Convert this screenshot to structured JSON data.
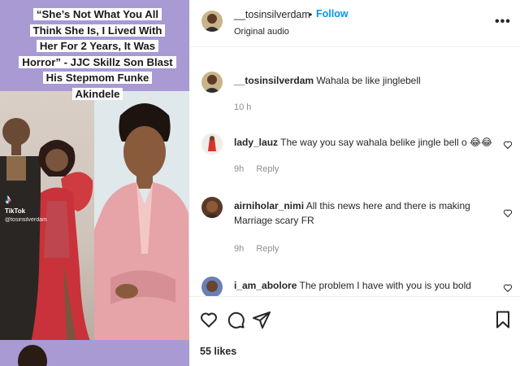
{
  "media": {
    "headline": [
      "“She’s Not What You All",
      "Think She Is, I Lived With",
      "Her For 2 Years, It Was",
      "Horror” - JJC Skillz Son Blast",
      "His Stepmom Funke",
      "Akindele"
    ],
    "tiktok_logo": "♪",
    "tiktok_name": "TikTok",
    "tiktok_handle": "@tosinsilverdam"
  },
  "post": {
    "username": "__tosinsilverdam",
    "dot": "•",
    "follow_label": "Follow",
    "audio_label": "Original audio",
    "more_label": "•••"
  },
  "comments": [
    {
      "username": "__tosinsilverdam",
      "text": "Wahala be like jinglebell",
      "time": "10 h",
      "reply": ""
    },
    {
      "username": "lady_lauz",
      "text": "The way you say wahala belike jingle bell o 😂😂",
      "time": "9h",
      "reply": "Reply"
    },
    {
      "username": "airniholar_nimi",
      "text": "All this news here and there is making Marriage scary FR",
      "time": "9h",
      "reply": "Reply"
    },
    {
      "username": "i_am_abolore",
      "text": "The problem I have with you is you bold enough",
      "time": "",
      "reply": ""
    }
  ],
  "likes_label": "55 likes",
  "icons": [
    "heart-icon",
    "comment-icon",
    "share-icon",
    "bookmark-icon",
    "more-icon"
  ]
}
